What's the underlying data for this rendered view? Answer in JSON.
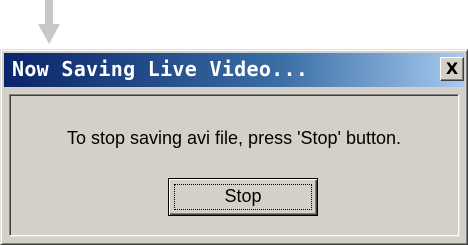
{
  "dialog": {
    "title": "Now Saving Live Video...",
    "close_label": "X",
    "message": "To stop saving avi file, press 'Stop' button.",
    "stop_label": "Stop"
  },
  "colors": {
    "title_start": "#0a246a",
    "title_end": "#a6caf0",
    "window_bg": "#d4d0c8",
    "arrow": "#c8c8c8"
  },
  "icons": {
    "arrow": "down-arrow-icon"
  }
}
